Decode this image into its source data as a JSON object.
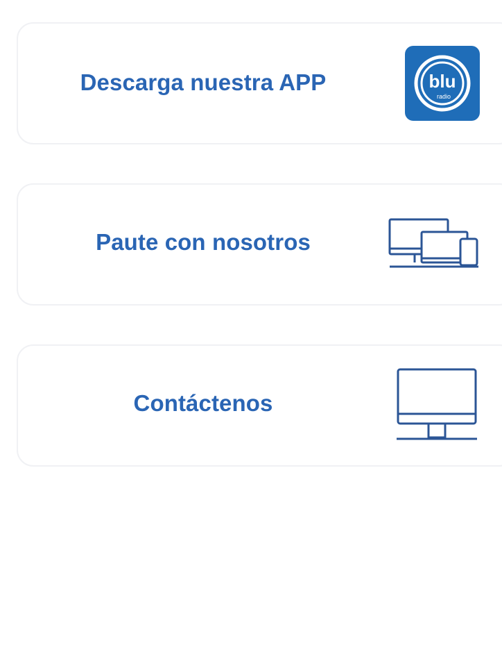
{
  "cards": [
    {
      "label": "Descarga nuestra APP",
      "icon": "blu-radio-app-icon"
    },
    {
      "label": "Paute con nosotros",
      "icon": "devices-icon"
    },
    {
      "label": "Contáctenos",
      "icon": "desktop-monitor-icon"
    }
  ],
  "app_icon": {
    "brand_text": "blu",
    "sub_text": "radio"
  },
  "colors": {
    "label": "#2a65b4",
    "brand_blue": "#1f6db8",
    "icon_line": "#2b5596",
    "card_border": "#f0f1f4"
  }
}
